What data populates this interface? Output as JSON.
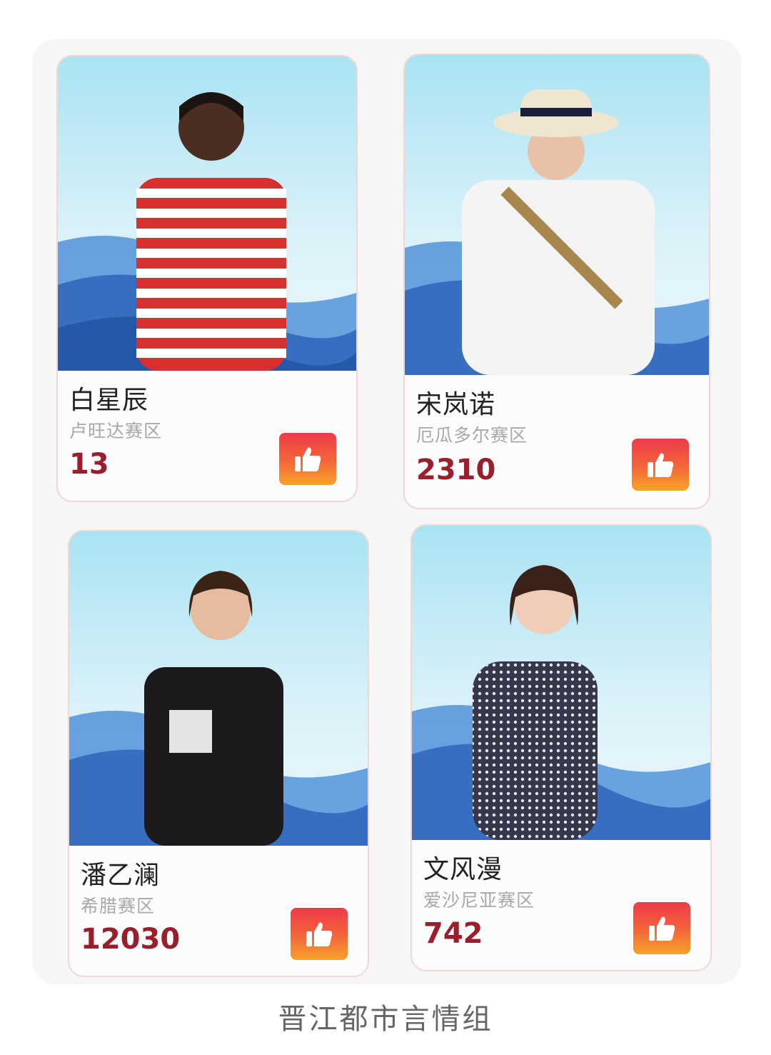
{
  "contestants": [
    {
      "name": "白星辰",
      "region": "卢旺达赛区",
      "votes": "13",
      "shirt": "#d8302f",
      "shirt2": "#ffffff",
      "skin": "#4a2e22",
      "hair": "#1b1410"
    },
    {
      "name": "宋岚诺",
      "region": "厄瓜多尔赛区",
      "votes": "2310",
      "shirt": "#f4f4f4",
      "shirt2": "#f4f4f4",
      "skin": "#e8c2a8",
      "hair": "#2a1c16"
    },
    {
      "name": "潘乙澜",
      "region": "希腊赛区",
      "votes": "12030",
      "shirt": "#1c1a1d",
      "shirt2": "#1c1a1d",
      "skin": "#e6bba0",
      "hair": "#3a2418"
    },
    {
      "name": "文风漫",
      "region": "爱沙尼亚赛区",
      "votes": "742",
      "shirt": "#34384a",
      "shirt2": "#e6e6ee",
      "skin": "#f0cdb8",
      "hair": "#3a2218"
    }
  ],
  "like_icon": "thumbs-up-icon",
  "caption": "晋江都市言情组"
}
